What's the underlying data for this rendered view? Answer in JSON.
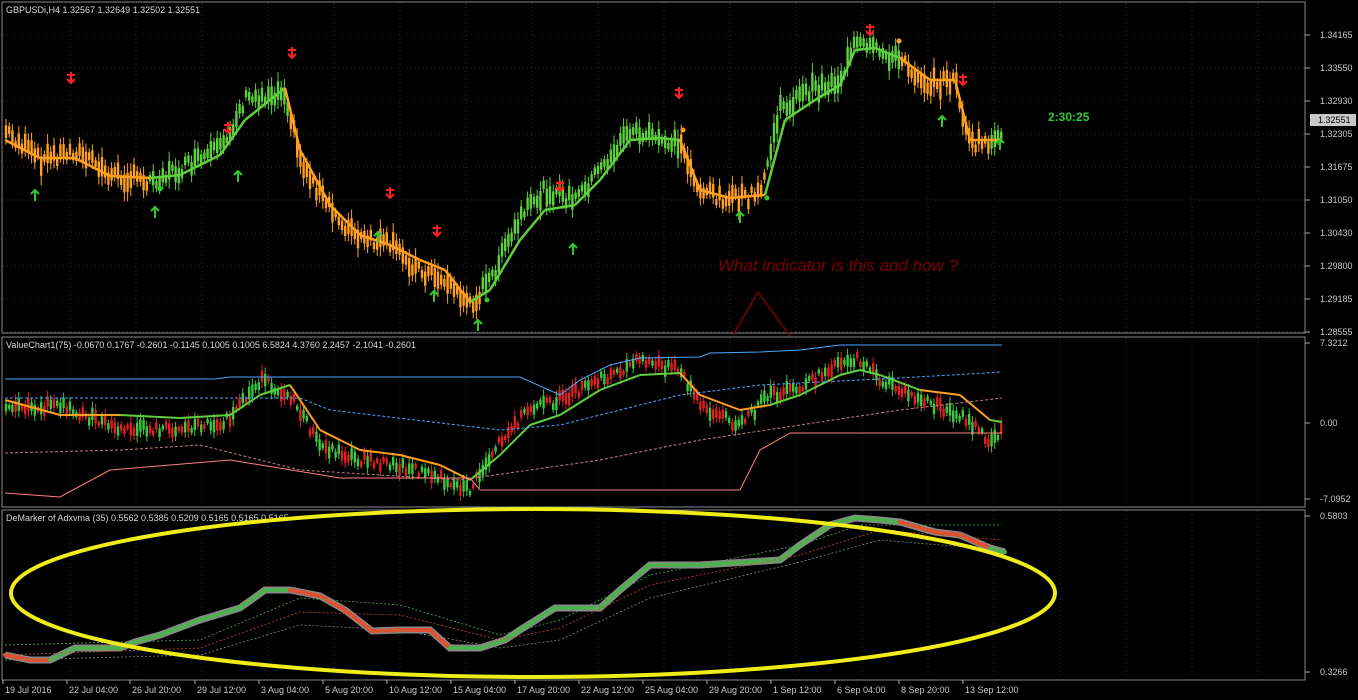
{
  "main": {
    "header": "GBPUSDi,H4  1.32567 1.32649 1.32502 1.32551",
    "price_labels": [
      "1.34165",
      "1.33550",
      "1.32930",
      "1.32305",
      "1.31675",
      "1.31050",
      "1.30430",
      "1.29800",
      "1.29185",
      "1.28555"
    ],
    "current_price": "1.32551",
    "timer": "2:30:25",
    "annotation": "What indicator is this and how ?",
    "colors": {
      "up": "#5ed040",
      "down": "#ffa020",
      "arrow_up": "#32c832",
      "arrow_down": "#ff2020"
    }
  },
  "value_chart": {
    "header": "ValueChart1(75) -0.0670 0.1767 -0.2601 -0.1145 0.1005 0.1005 6.5824 4.3760 2.2457 -2.1041 -0.2601",
    "labels": [
      "7.3212",
      "0.00",
      "-7.0952"
    ]
  },
  "demarker": {
    "header": "DeMarker of Adxvma (35) 0.5562 0.5385 0.5209 0.5165 0.5165 0.5165",
    "labels": [
      "0.5803",
      "0.3266"
    ]
  },
  "time_labels": [
    "19 Jul 2016",
    "22 Jul 04:00",
    "26 Jul 20:00",
    "29 Jul 12:00",
    "3 Aug 04:00",
    "5 Aug 20:00",
    "10 Aug 12:00",
    "15 Aug 04:00",
    "17 Aug 20:00",
    "22 Aug 12:00",
    "25 Aug 04:00",
    "29 Aug 20:00",
    "1 Sep 12:00",
    "6 Sep 04:00",
    "8 Sep 20:00",
    "13 Sep 12:00"
  ]
}
